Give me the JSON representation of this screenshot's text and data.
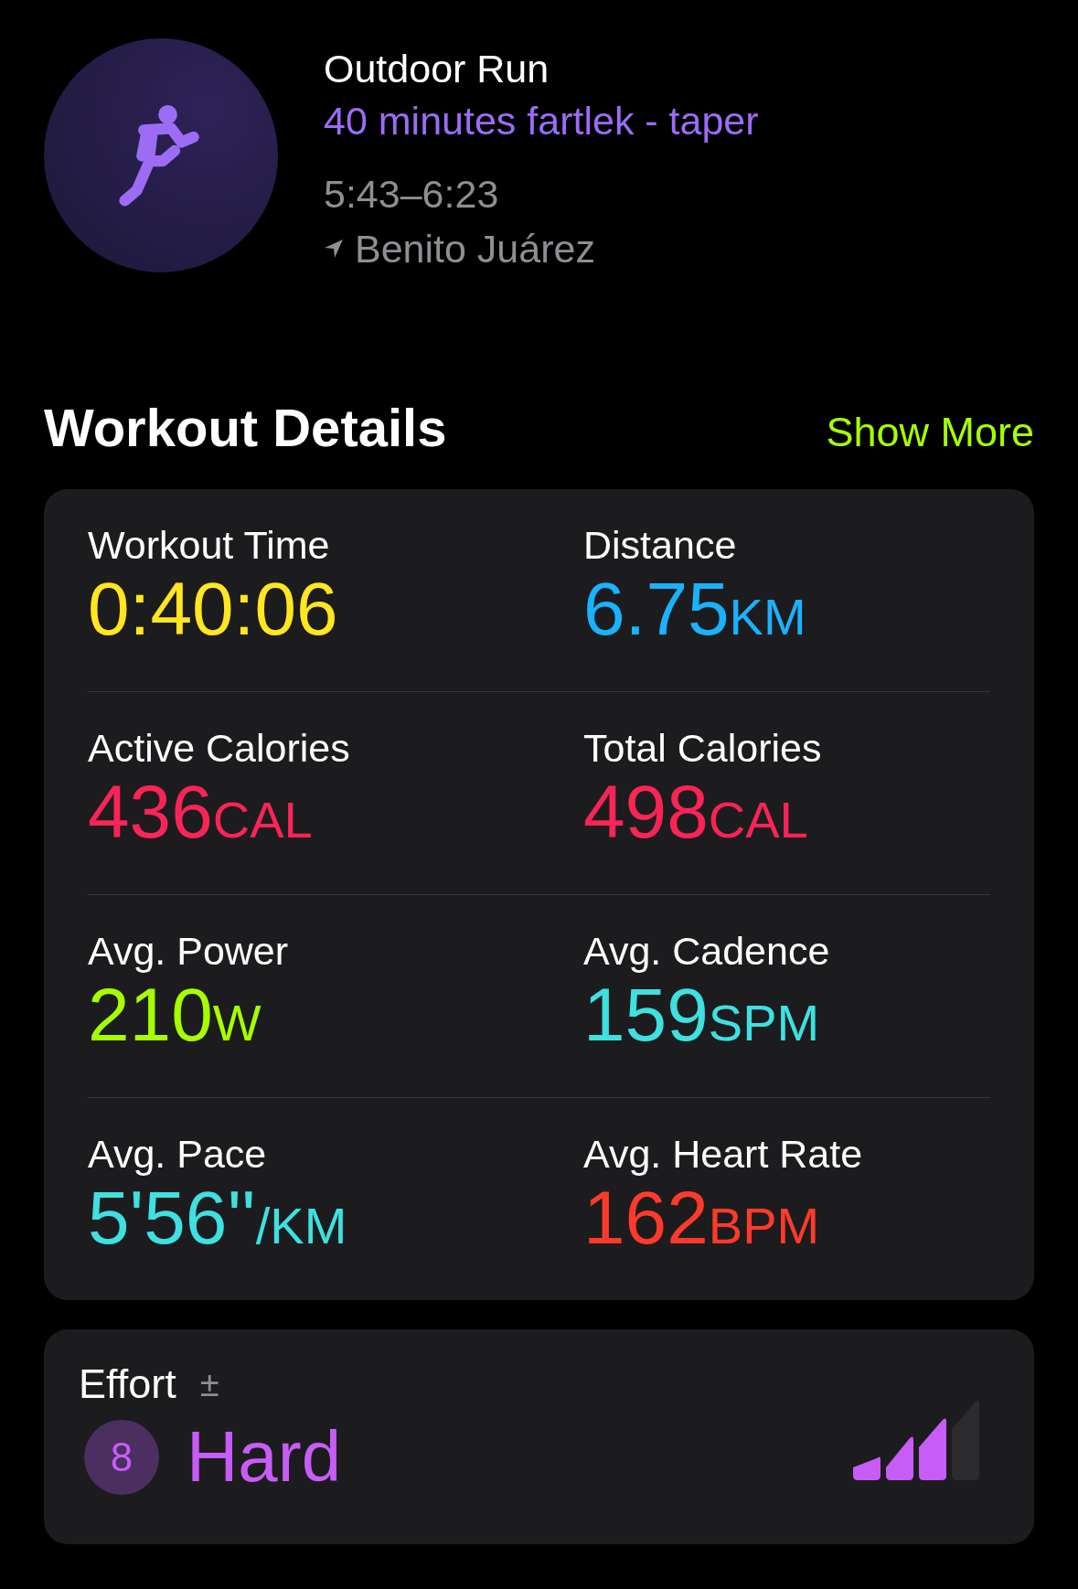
{
  "workout": {
    "title": "Outdoor Run",
    "subtitle": "40 minutes fartlek - taper",
    "time": "5:43–6:23",
    "location": "Benito Juárez"
  },
  "section": {
    "title": "Workout Details",
    "action": "Show More"
  },
  "metrics": [
    {
      "label": "Workout Time",
      "value": "0:40:06",
      "color": "#ffe620"
    },
    {
      "label": "Distance",
      "value": "6.75",
      "unit": "KM",
      "color": "#1ab2ff"
    },
    {
      "label": "Active Calories",
      "value": "436",
      "unit": "CAL",
      "color": "#fa2456"
    },
    {
      "label": "Total Calories",
      "value": "498",
      "unit": "CAL",
      "color": "#fa2456"
    },
    {
      "label": "Avg. Power",
      "value": "210",
      "unit": "W",
      "color": "#a6ff00"
    },
    {
      "label": "Avg. Cadence",
      "value": "159",
      "unit": "SPM",
      "color": "#3ee0e0"
    },
    {
      "label": "Avg. Pace",
      "value": "5'56''",
      "unit": "/KM",
      "color": "#3ee0e0"
    },
    {
      "label": "Avg. Heart Rate",
      "value": "162",
      "unit": "BPM",
      "color": "#ff3a2a"
    }
  ],
  "effort": {
    "label": "Effort",
    "symbol": "±",
    "score": "8",
    "rating": "Hard",
    "level": 0.75
  }
}
